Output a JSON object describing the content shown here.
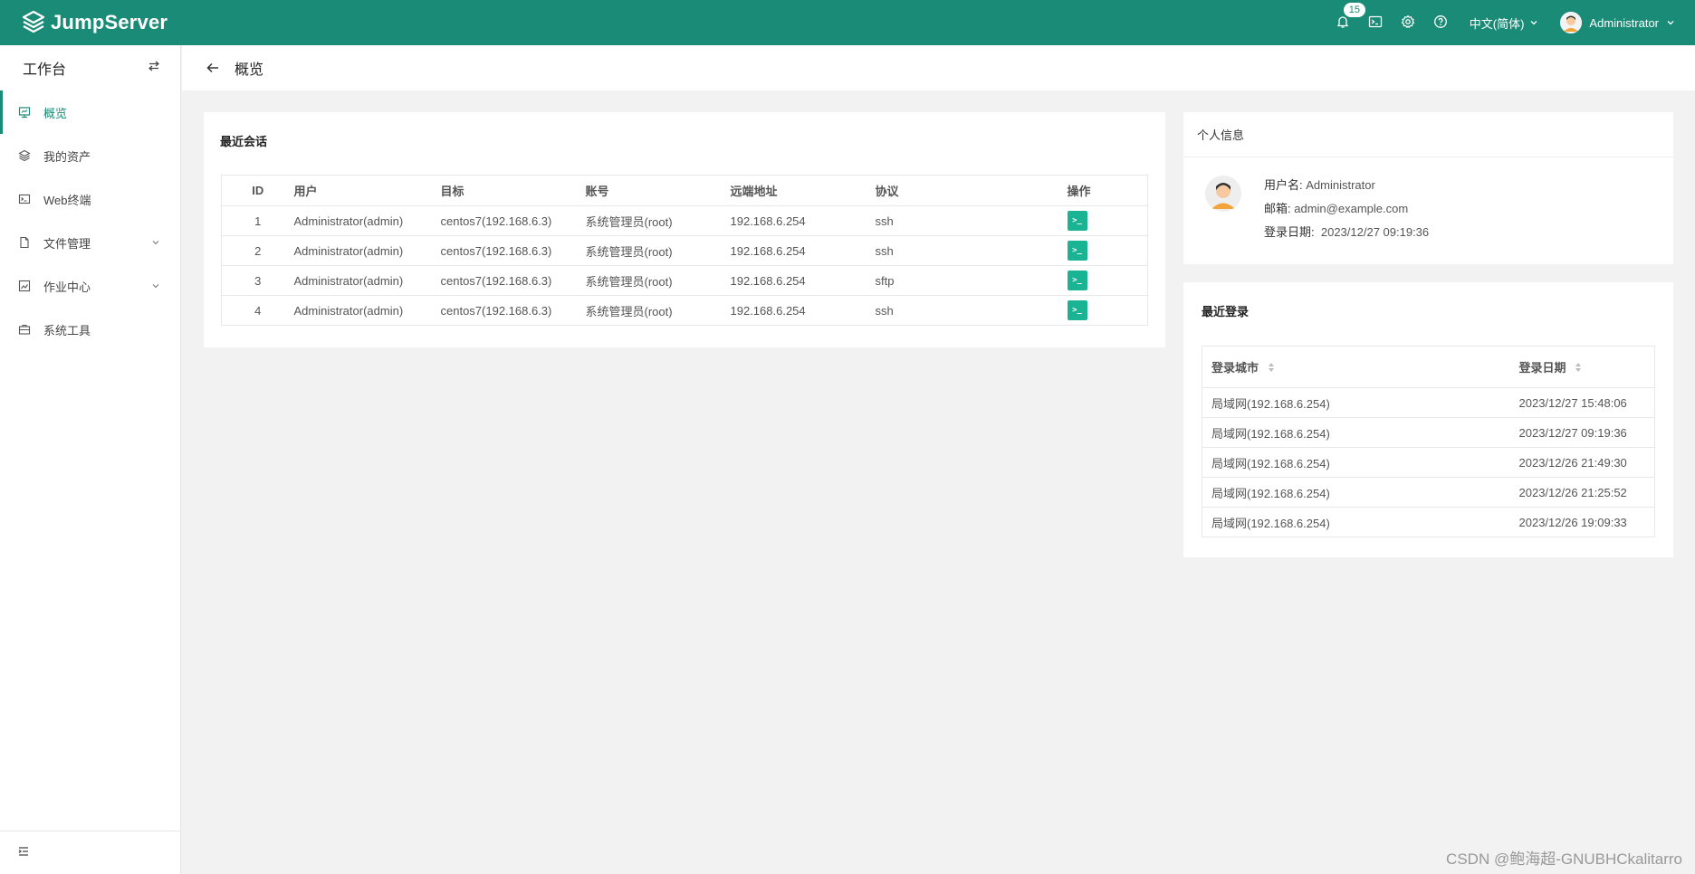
{
  "app": {
    "logo_text": "JumpServer",
    "brand_color": "#1a8b76",
    "accent_color": "#1ab394"
  },
  "header": {
    "notification_count": "15",
    "language": "中文(简体)",
    "username": "Administrator",
    "icons": [
      "bell-icon",
      "terminal-icon",
      "gear-icon",
      "help-icon"
    ]
  },
  "sidebar": {
    "workspace_title": "工作台",
    "items": [
      {
        "label": "概览",
        "icon": "dashboard-icon",
        "active": true
      },
      {
        "label": "我的资产",
        "icon": "layers-icon"
      },
      {
        "label": "Web终端",
        "icon": "terminal-icon"
      },
      {
        "label": "文件管理",
        "icon": "file-icon",
        "expandable": true
      },
      {
        "label": "作业中心",
        "icon": "job-icon",
        "expandable": true
      },
      {
        "label": "系统工具",
        "icon": "toolbox-icon"
      }
    ]
  },
  "page": {
    "title": "概览"
  },
  "recent_sessions": {
    "title": "最近会话",
    "columns": [
      "ID",
      "用户",
      "目标",
      "账号",
      "远端地址",
      "协议",
      "操作"
    ],
    "rows": [
      {
        "id": "1",
        "user": "Administrator(admin)",
        "target": "centos7(192.168.6.3)",
        "account": "系统管理员(root)",
        "remote_addr": "192.168.6.254",
        "protocol": "ssh"
      },
      {
        "id": "2",
        "user": "Administrator(admin)",
        "target": "centos7(192.168.6.3)",
        "account": "系统管理员(root)",
        "remote_addr": "192.168.6.254",
        "protocol": "ssh"
      },
      {
        "id": "3",
        "user": "Administrator(admin)",
        "target": "centos7(192.168.6.3)",
        "account": "系统管理员(root)",
        "remote_addr": "192.168.6.254",
        "protocol": "sftp"
      },
      {
        "id": "4",
        "user": "Administrator(admin)",
        "target": "centos7(192.168.6.3)",
        "account": "系统管理员(root)",
        "remote_addr": "192.168.6.254",
        "protocol": "ssh"
      }
    ],
    "action_label": ">_"
  },
  "profile": {
    "title": "个人信息",
    "username_label": "用户名:",
    "username": "Administrator",
    "email_label": "邮箱:",
    "email": "admin@example.com",
    "login_date_label": "登录日期:",
    "login_date": "2023/12/27 09:19:36"
  },
  "recent_logins": {
    "title": "最近登录",
    "columns": [
      "登录城市",
      "登录日期"
    ],
    "rows": [
      {
        "city": "局域网(192.168.6.254)",
        "date": "2023/12/27 15:48:06"
      },
      {
        "city": "局域网(192.168.6.254)",
        "date": "2023/12/27 09:19:36"
      },
      {
        "city": "局域网(192.168.6.254)",
        "date": "2023/12/26 21:49:30"
      },
      {
        "city": "局域网(192.168.6.254)",
        "date": "2023/12/26 21:25:52"
      },
      {
        "city": "局域网(192.168.6.254)",
        "date": "2023/12/26 19:09:33"
      }
    ]
  },
  "watermark": "CSDN @鲍海超-GNUBHCkalitarro"
}
